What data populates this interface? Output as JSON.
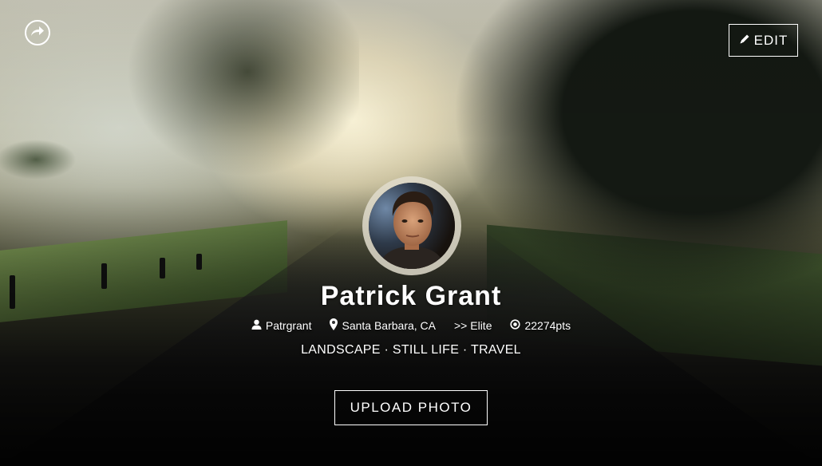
{
  "profile": {
    "name": "Patrick Grant",
    "username": "Patrgrant",
    "location": "Santa Barbara, CA",
    "level": ">> Elite",
    "points": "22274pts",
    "tags": "LANDSCAPE · STILL LIFE · TRAVEL"
  },
  "actions": {
    "edit_label": "EDIT",
    "upload_label": "UPLOAD PHOTO"
  },
  "icons": {
    "share": "share-arrow-icon",
    "edit": "pencil-icon",
    "user": "user-icon",
    "location": "map-pin-icon",
    "points": "target-icon"
  }
}
